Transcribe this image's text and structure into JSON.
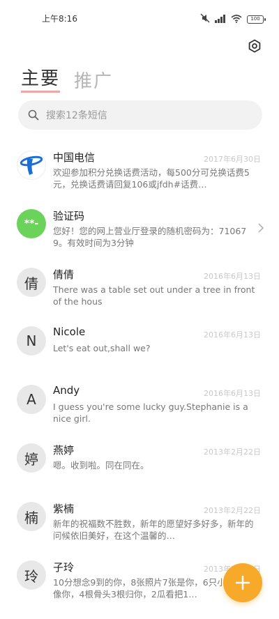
{
  "status_bar": {
    "time": "上午8:16",
    "battery": "100"
  },
  "tabs": [
    {
      "label": "主要",
      "active": true
    },
    {
      "label": "推广",
      "active": false
    }
  ],
  "search": {
    "placeholder": "搜索12条短信"
  },
  "conversations": [
    {
      "name": "中国电信",
      "date": "2017年6月30日",
      "snippet": "欢迎参加积分兑换话费活动，每500分可兑换话费5元，兑换话费请回复106或jfdh#话费…",
      "avatar": "telecom-logo",
      "avatar_text": ""
    },
    {
      "name": "验证码",
      "date": "",
      "snippet": "您好！您的网上营业厅登录的随机密码为：710679。有效时间为3分钟",
      "avatar": "green",
      "avatar_text": "**-"
    },
    {
      "name": "倩倩",
      "date": "2016年6月13日",
      "snippet": "There was a table set out under a tree in front of the hous",
      "avatar": "letter",
      "avatar_text": "倩"
    },
    {
      "name": "Nicole",
      "date": "2016年6月13日",
      "snippet": "Let's eat out,shall we?",
      "avatar": "letter",
      "avatar_text": "N"
    },
    {
      "name": "Andy",
      "date": "2016年6月13日",
      "snippet": "I guess you're some lucky guy.Stephanie is a nice girl.",
      "avatar": "letter",
      "avatar_text": "A"
    },
    {
      "name": "燕婷",
      "date": "2013年2月22日",
      "snippet": "嗯。收到啦。同在同在。",
      "avatar": "letter",
      "avatar_text": "婷"
    },
    {
      "name": "紫楠",
      "date": "2013年2月22日",
      "snippet": "新年的祝福数不胜数，新年的愿望好多好多，新年的问候依旧美好，在这个温馨的…",
      "avatar": "letter",
      "avatar_text": "楠"
    },
    {
      "name": "子玲",
      "date": "2013年2月22日",
      "snippet": "10分想念9到的你，8张照片7张是你，6只小狗5只像你，4根骨头3根归你，2瓜看把1…",
      "avatar": "letter",
      "avatar_text": "玲"
    }
  ],
  "colors": {
    "accent": "#f7a92a",
    "tab_underline": "#f1a6a6",
    "verify_avatar": "#6cd35a",
    "telecom_blue": "#1a6fd6"
  }
}
